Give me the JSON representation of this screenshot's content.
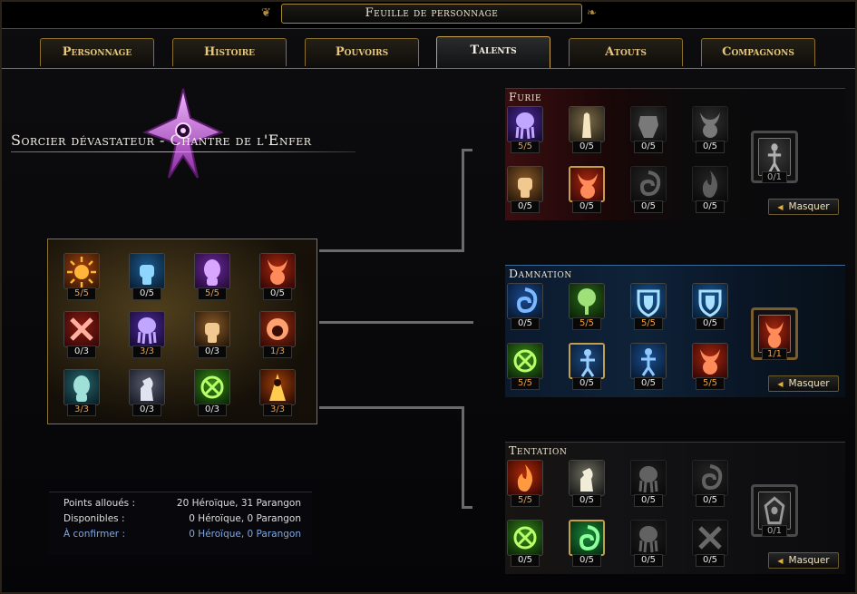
{
  "window": {
    "title": "Feuille de personnage"
  },
  "tabs": [
    {
      "label": "Personnage",
      "active": false
    },
    {
      "label": "Histoire",
      "active": false
    },
    {
      "label": "Pouvoirs",
      "active": false
    },
    {
      "label": "Talents",
      "active": true
    },
    {
      "label": "Atouts",
      "active": false
    },
    {
      "label": "Compagnons",
      "active": false
    }
  ],
  "class_title": "Sorcier dévastateur - Chantre de l'Enfer",
  "heroic_talents": [
    {
      "icon": "sun-flame-icon",
      "count": "5/5",
      "full": true
    },
    {
      "icon": "fist-icon",
      "count": "0/5",
      "full": false
    },
    {
      "icon": "purple-head-icon",
      "count": "5/5",
      "full": true
    },
    {
      "icon": "horned-demon-icon",
      "count": "0/5",
      "full": false
    },
    {
      "icon": "crossed-weapons-icon",
      "count": "0/3",
      "full": false
    },
    {
      "icon": "tentacle-face-icon",
      "count": "3/3",
      "full": true
    },
    {
      "icon": "bronze-fist-icon",
      "count": "0/3",
      "full": false
    },
    {
      "icon": "lion-head-icon",
      "count": "1/3",
      "full": true
    },
    {
      "icon": "goblin-head-icon",
      "count": "3/3",
      "full": true
    },
    {
      "icon": "chess-knight-icon",
      "count": "0/3",
      "full": false
    },
    {
      "icon": "green-rune-icon",
      "count": "0/3",
      "full": false
    },
    {
      "icon": "fire-mage-icon",
      "count": "3/3",
      "full": true
    }
  ],
  "stats": {
    "allocated_label": "Points alloués :",
    "allocated_value": "20 Héroïque, 31 Parangon",
    "available_label": "Disponibles :",
    "available_value": "0 Héroïque, 0 Parangon",
    "confirm_label": "À confirmer :",
    "confirm_value": "0 Héroïque, 0 Parangon"
  },
  "trees": [
    {
      "name": "Furie",
      "hide_label": "Masquer",
      "capstone": {
        "icon": "winged-figure-icon",
        "count": "0/1",
        "active": false
      },
      "talents": [
        {
          "icon": "tentacle-face-icon",
          "count": "5/5",
          "full": true,
          "selected": false,
          "locked": false
        },
        {
          "icon": "praying-hands-icon",
          "count": "0/5",
          "full": false,
          "selected": false,
          "locked": false
        },
        {
          "icon": "armor-icon",
          "count": "0/5",
          "full": false,
          "selected": false,
          "locked": true
        },
        {
          "icon": "demon-face-icon",
          "count": "0/5",
          "full": false,
          "selected": false,
          "locked": true
        },
        {
          "icon": "bronze-fist-icon",
          "count": "0/5",
          "full": false,
          "selected": false,
          "locked": false
        },
        {
          "icon": "horned-demon-icon",
          "count": "0/5",
          "full": false,
          "selected": true,
          "locked": false
        },
        {
          "icon": "swirl-rune-icon",
          "count": "0/5",
          "full": false,
          "selected": false,
          "locked": true
        },
        {
          "icon": "flame-icon",
          "count": "0/5",
          "full": false,
          "selected": false,
          "locked": true
        }
      ]
    },
    {
      "name": "Damnation",
      "hide_label": "Masquer",
      "capstone": {
        "icon": "horned-demon-icon",
        "count": "1/1",
        "active": true
      },
      "talents": [
        {
          "icon": "swirl-rune-icon",
          "count": "0/5",
          "full": false,
          "selected": false,
          "locked": false
        },
        {
          "icon": "tree-icon",
          "count": "5/5",
          "full": true,
          "selected": false,
          "locked": false
        },
        {
          "icon": "shield-icon",
          "count": "5/5",
          "full": true,
          "selected": false,
          "locked": false
        },
        {
          "icon": "shield-icon",
          "count": "0/5",
          "full": false,
          "selected": false,
          "locked": false
        },
        {
          "icon": "green-rune-icon",
          "count": "5/5",
          "full": true,
          "selected": false,
          "locked": false
        },
        {
          "icon": "spirit-figure-icon",
          "count": "0/5",
          "full": false,
          "selected": true,
          "locked": false
        },
        {
          "icon": "blue-dancer-icon",
          "count": "0/5",
          "full": false,
          "selected": false,
          "locked": false
        },
        {
          "icon": "horned-demon-icon",
          "count": "5/5",
          "full": true,
          "selected": false,
          "locked": false
        }
      ]
    },
    {
      "name": "Tentation",
      "hide_label": "Masquer",
      "capstone": {
        "icon": "dark-crest-icon",
        "count": "0/1",
        "active": false
      },
      "talents": [
        {
          "icon": "flame-icon",
          "count": "5/5",
          "full": true,
          "selected": false,
          "locked": false
        },
        {
          "icon": "armored-knight-icon",
          "count": "0/5",
          "full": false,
          "selected": false,
          "locked": false
        },
        {
          "icon": "tentacle-face-icon",
          "count": "0/5",
          "full": false,
          "selected": false,
          "locked": true
        },
        {
          "icon": "swirl-rune-icon",
          "count": "0/5",
          "full": false,
          "selected": false,
          "locked": true
        },
        {
          "icon": "green-rune-icon",
          "count": "0/5",
          "full": false,
          "selected": false,
          "locked": false
        },
        {
          "icon": "green-spiral-icon",
          "count": "0/5",
          "full": false,
          "selected": true,
          "locked": false
        },
        {
          "icon": "tentacle-face-icon",
          "count": "0/5",
          "full": false,
          "selected": false,
          "locked": true
        },
        {
          "icon": "crossed-weapons-icon",
          "count": "0/5",
          "full": false,
          "selected": false,
          "locked": true
        }
      ]
    }
  ]
}
